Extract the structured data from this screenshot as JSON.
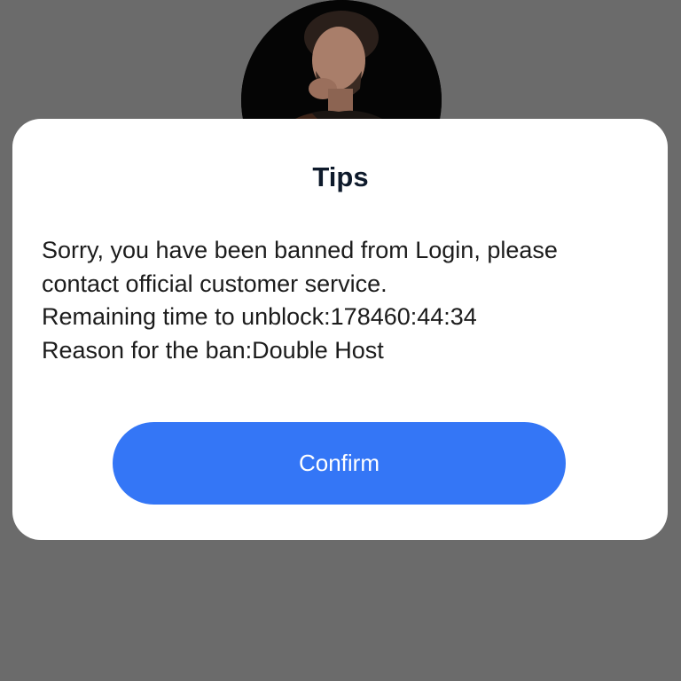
{
  "dialog": {
    "title": "Tips",
    "message": "Sorry, you have been banned from Login, please\ncontact official customer service.\nRemaining time to unblock:178460:44:34\nReason for the ban:Double Host",
    "confirm_label": "Confirm"
  },
  "colors": {
    "overlay": "#6b6b6b",
    "dialog_background": "#ffffff",
    "title_text": "#0e1a2b",
    "accent_button": "#3476f6",
    "button_text": "#ffffff"
  },
  "icons": {
    "avatar": "user-profile-photo"
  }
}
